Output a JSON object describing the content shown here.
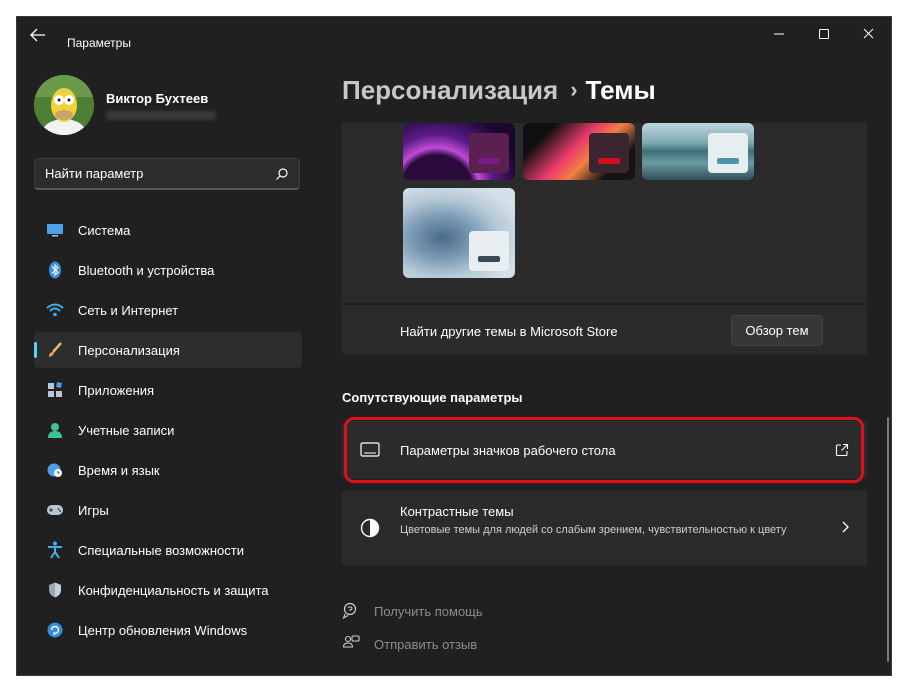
{
  "window": {
    "title": "Параметры"
  },
  "user": {
    "name": "Виктор Бухтеев"
  },
  "search": {
    "placeholder": "Найти параметр"
  },
  "sidebar": {
    "items": [
      {
        "label": "Система",
        "icon": "display-icon"
      },
      {
        "label": "Bluetooth и устройства",
        "icon": "bluetooth-icon"
      },
      {
        "label": "Сеть и Интернет",
        "icon": "wifi-icon"
      },
      {
        "label": "Персонализация",
        "icon": "brush-icon",
        "active": true
      },
      {
        "label": "Приложения",
        "icon": "apps-icon"
      },
      {
        "label": "Учетные записи",
        "icon": "person-icon"
      },
      {
        "label": "Время и язык",
        "icon": "globe-clock-icon"
      },
      {
        "label": "Игры",
        "icon": "gamepad-icon"
      },
      {
        "label": "Специальные возможности",
        "icon": "accessibility-icon"
      },
      {
        "label": "Конфиденциальность и защита",
        "icon": "shield-icon"
      },
      {
        "label": "Центр обновления Windows",
        "icon": "update-icon"
      }
    ]
  },
  "breadcrumb": {
    "parent": "Персонализация",
    "separator": "›",
    "current": "Темы"
  },
  "themes": {
    "store_label": "Найти другие темы в Microsoft Store",
    "browse_button": "Обзор тем"
  },
  "related": {
    "title": "Сопутствующие параметры",
    "desktop_icons": {
      "title": "Параметры значков рабочего стола"
    },
    "contrast": {
      "title": "Контрастные темы",
      "subtitle": "Цветовые темы для людей со слабым зрением, чувствительностью к цвету"
    }
  },
  "help": {
    "get_help": "Получить помощь",
    "feedback": "Отправить отзыв"
  },
  "colors": {
    "accent": "#60cdff",
    "highlight": "#e0101a"
  }
}
